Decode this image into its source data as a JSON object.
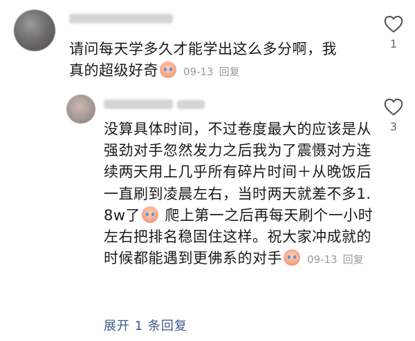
{
  "comment": {
    "text": "请问每天学多久才能学出这么多分啊，我真的超级好奇",
    "date": "09-13",
    "reply_label": "回复",
    "likes": "1"
  },
  "reply": {
    "text_before_emoji_1": "没算具体时间，不过卷度最大的应该是从强劲对手忽然发力之后我为了震慑对方连续两天用上几乎所有碎片时间＋从晚饭后一直刷到凌晨左右，当时两天就差不多1.8w了",
    "text_between_emojis": " 爬上第一之后再每天刷个一小时左右把排名稳固住这样。祝大家冲成就的时候都能遇到更佛系的对手",
    "date": "09-13",
    "reply_label": "回复",
    "likes": "3"
  },
  "expand": {
    "label": "展开 1 条回复"
  }
}
